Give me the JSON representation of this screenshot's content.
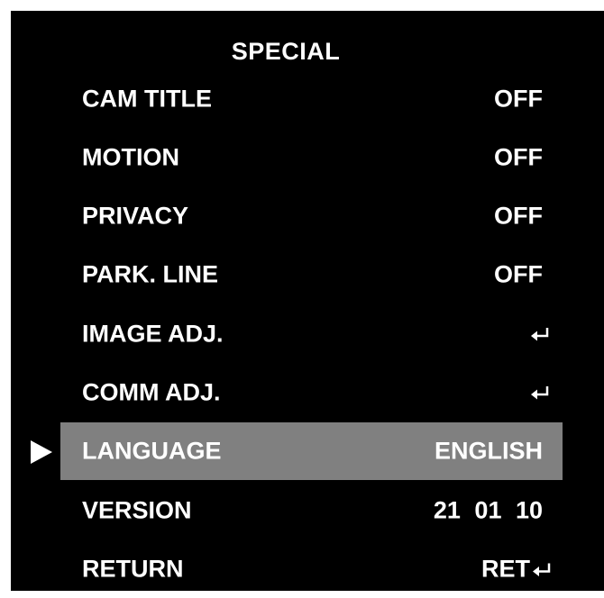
{
  "menu": {
    "title": "SPECIAL",
    "items": [
      {
        "label": "CAM TITLE",
        "value": "OFF"
      },
      {
        "label": "MOTION",
        "value": "OFF"
      },
      {
        "label": "PRIVACY",
        "value": "OFF"
      },
      {
        "label": "PARK. LINE",
        "value": "OFF"
      },
      {
        "label": "IMAGE ADJ.",
        "icon": "enter-arrow-icon"
      },
      {
        "label": "COMM ADJ.",
        "icon": "enter-arrow-icon"
      },
      {
        "label": "LANGUAGE",
        "value": "ENGLISH",
        "selected": true
      },
      {
        "label": "VERSION",
        "value": "21 01 10"
      },
      {
        "label": "RETURN",
        "value": "RET",
        "icon": "enter-arrow-icon"
      }
    ],
    "colors": {
      "background": "#000000",
      "text": "#ffffff",
      "highlight": "#808080"
    }
  }
}
